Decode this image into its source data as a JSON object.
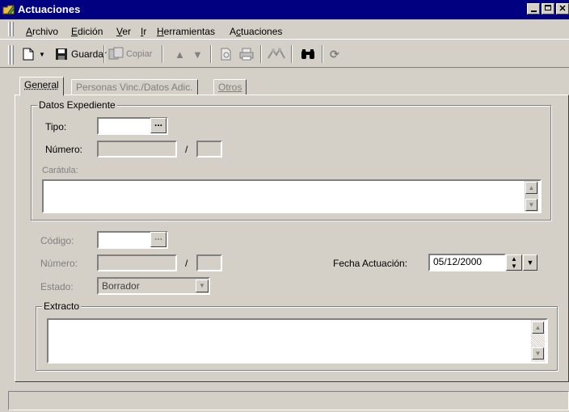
{
  "window": {
    "title": "Actuaciones",
    "icon": "folder-pencil-icon",
    "controls": [
      "minimize-icon",
      "maximize-icon",
      "close-icon"
    ]
  },
  "menu": {
    "archivo": "Archivo",
    "edicion": "Edición",
    "ver": "Ver",
    "ir": "Ir",
    "herramientas": "Herramientas",
    "actuaciones": "Actuaciones"
  },
  "toolbar": {
    "new_icon": "new-document-icon",
    "save_label": "Guardar",
    "copy_label": "Copiar",
    "nav_icons": [
      "arrow-up-icon",
      "arrow-down-icon"
    ],
    "other_icons": [
      "print-preview-icon",
      "print-icon",
      "workflow-icon",
      "binoculars-icon",
      "refresh-icon"
    ]
  },
  "tabs": {
    "general": "General",
    "personas": "Personas Vinc./Datos Adic.",
    "otros": "Otros"
  },
  "expediente": {
    "group_label": "Datos Expediente",
    "tipo_label": "Tipo:",
    "tipo_value": "",
    "numero_label": "Número:",
    "numero_value": "",
    "separator": "/",
    "anio_value": "",
    "caratula_label": "Carátula:",
    "caratula_value": ""
  },
  "actuacion": {
    "codigo_label": "Código:",
    "codigo_value": "",
    "numero_label": "Número:",
    "numero_value": "",
    "separator": "/",
    "anio_value": "",
    "fecha_label": "Fecha Actuación:",
    "fecha_value": "05/12/2000",
    "estado_label": "Estado:",
    "estado_value": "Borrador",
    "extracto_label": "Extracto",
    "extracto_value": ""
  },
  "dots_label": "...",
  "status": ""
}
